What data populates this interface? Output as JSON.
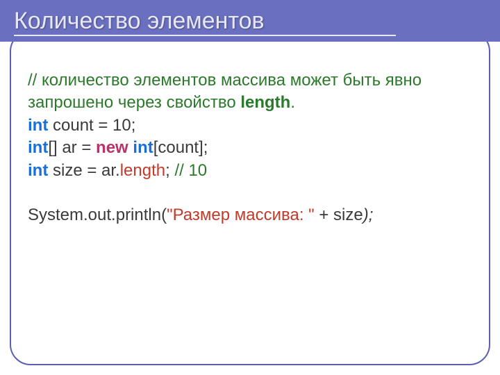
{
  "title": "Количество элементов",
  "code": {
    "comment": "// количество элементов массива может быть явно запрошено через свойство ",
    "comment_kw": "length",
    "comment_end": ".",
    "l1_kw": "int",
    "l1_rest": " count = 10;",
    "l2_kw1": "int",
    "l2_p1": "[] ar = ",
    "l2_kw2": "new ",
    "l2_kw3": "int",
    "l2_p2": "[count];",
    "l3_kw": "int",
    "l3_p1": " size = ar.",
    "l3_len": "length",
    "l3_p2": "; ",
    "l3_cm": "// 10",
    "l4_p1": "System.out.println(",
    "l4_str": "\"Размер массива: \"",
    "l4_p2": " + size",
    "l4_p3": ");"
  }
}
